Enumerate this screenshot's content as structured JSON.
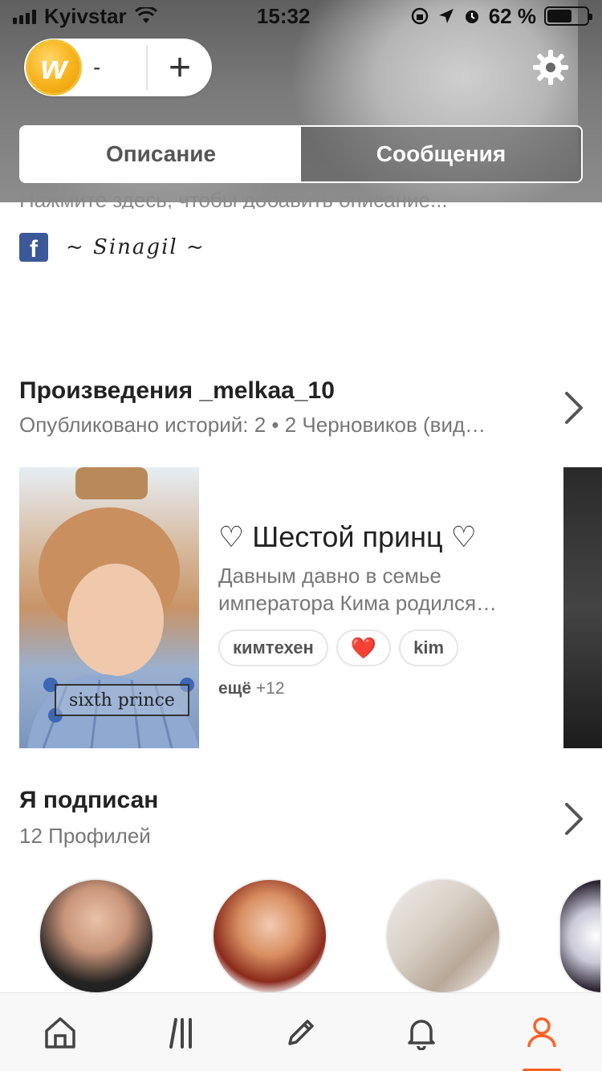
{
  "status_bar": {
    "carrier": "Kyivstar",
    "time": "15:32",
    "battery": "62 %",
    "battery_level": 0.62
  },
  "coins": {
    "icon": "wattpad-coin-icon",
    "letter": "w",
    "count": "-",
    "add_label": "+"
  },
  "settings": {
    "icon": "gear-icon"
  },
  "tabs": {
    "about": "Описание",
    "messages": "Сообщения"
  },
  "about": {
    "text": "Нажмите здесь, чтобы добавить описание...",
    "facebook_icon": "facebook-icon",
    "facebook_name": "~ Sinagil ~"
  },
  "works": {
    "title": "Произведения _melkaa_10",
    "subtitle": "Опубликовано историй: 2 • 2 Черновиков (вид…",
    "story": {
      "cover_caption": "sixth prince",
      "title": "♡ Шестой принц ♡",
      "description": "Давным давно в семье императора Кима родился…",
      "tags": [
        "кимтехен",
        "❤️",
        "kim"
      ],
      "more_label": "ещё",
      "more_count": "+12"
    }
  },
  "following": {
    "title": "Я подписан",
    "subtitle": "12 Профилей"
  },
  "tabbar": {
    "items": [
      "home-icon",
      "library-icon",
      "write-icon",
      "notifications-icon",
      "profile-icon"
    ],
    "active": "profile-icon",
    "accent": "#ff6122"
  },
  "colors": {
    "accent": "#ff6122",
    "facebook": "#3b5998",
    "coin": "#f6b21b"
  }
}
